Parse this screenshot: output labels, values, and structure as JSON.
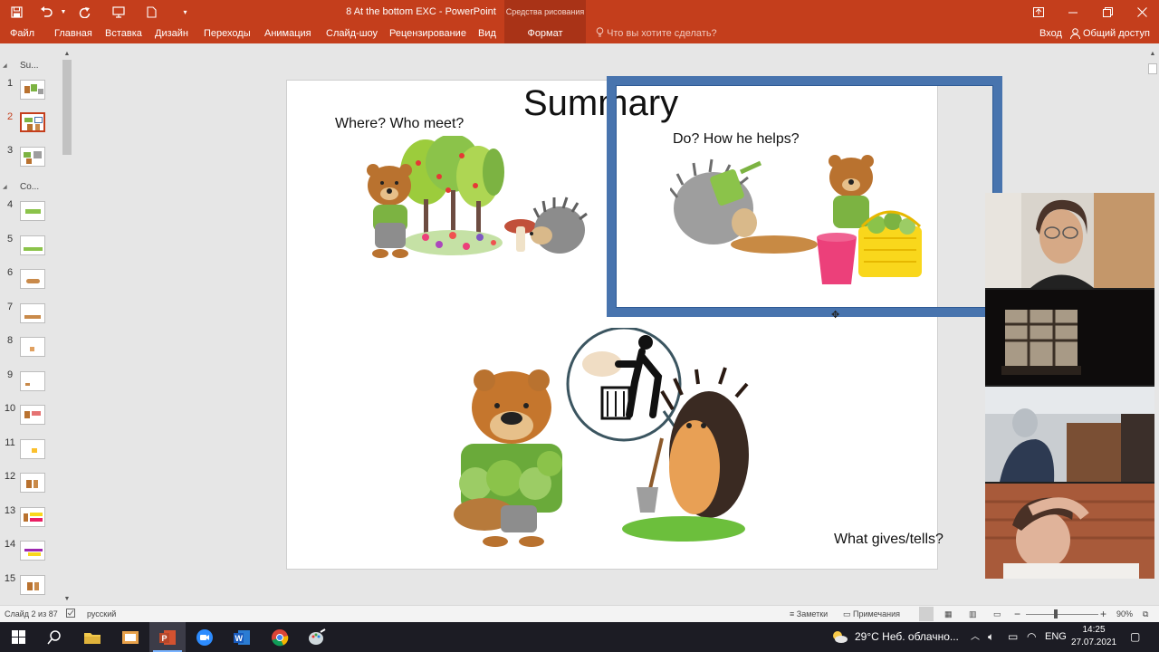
{
  "app": {
    "document_title": "8 At the bottom EXC  -  PowerPoint",
    "contextual_tab_group": "Средства рисования",
    "qat_icons": [
      "save-icon",
      "undo-icon",
      "redo-icon",
      "present-icon",
      "new-file-icon",
      "customize-icon"
    ],
    "window_controls": [
      "ribbon-display-icon",
      "minimize-icon",
      "restore-icon",
      "close-icon"
    ]
  },
  "ribbon": {
    "tabs": [
      "Файл",
      "Главная",
      "Вставка",
      "Дизайн",
      "Переходы",
      "Анимация",
      "Слайд-шоу",
      "Рецензирование",
      "Вид"
    ],
    "contextual_tab": "Формат",
    "tell_me": "Что вы хотите сделать?",
    "sign_in": "Вход",
    "share": "Общий доступ"
  },
  "thumbnails": {
    "sections": [
      {
        "label": "Su..."
      },
      {
        "label": "Co..."
      }
    ],
    "slides": [
      {
        "num": "1",
        "selected": false
      },
      {
        "num": "2",
        "selected": true
      },
      {
        "num": "3",
        "selected": false
      },
      {
        "num": "4",
        "selected": false
      },
      {
        "num": "5",
        "selected": false
      },
      {
        "num": "6",
        "selected": false
      },
      {
        "num": "7",
        "selected": false
      },
      {
        "num": "8",
        "selected": false
      },
      {
        "num": "9",
        "selected": false
      },
      {
        "num": "10",
        "selected": false
      },
      {
        "num": "11",
        "selected": false
      },
      {
        "num": "12",
        "selected": false
      },
      {
        "num": "13",
        "selected": false
      },
      {
        "num": "14",
        "selected": false
      },
      {
        "num": "15",
        "selected": false
      }
    ]
  },
  "slide": {
    "title": "Summary",
    "q1": "Where? Who meet?",
    "q2": "Do?  How he helps?",
    "q3": "What gives/tells?"
  },
  "statusbar": {
    "slide_info": "Слайд 2 из 87",
    "language": "русский",
    "notes": "Заметки",
    "comments": "Примечания",
    "zoom": "90%"
  },
  "taskbar": {
    "apps": [
      "start-icon",
      "search-icon",
      "file-explorer-icon",
      "photos-icon",
      "powerpoint-icon",
      "zoom-icon",
      "word-icon",
      "chrome-icon",
      "paint-icon"
    ],
    "weather": "29°C  Неб. облачно...",
    "lang": "ENG",
    "time": "14:25",
    "date": "27.07.2021"
  },
  "colors": {
    "accent": "#c43e1c",
    "selection_frame": "#4874ae"
  }
}
